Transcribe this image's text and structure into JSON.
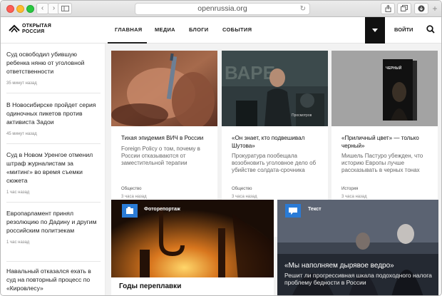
{
  "browser": {
    "url": "openrussia.org"
  },
  "site": {
    "logo_line1": "ОТКРЫТАЯ",
    "logo_line2": "РОССИЯ",
    "nav": [
      "ГЛАВНАЯ",
      "МЕДИА",
      "БЛОГИ",
      "СОБЫТИЯ"
    ],
    "login": "ВОЙТИ"
  },
  "sidebar": {
    "items": [
      {
        "title": "Суд освободил убившую ребенка няню от уголовной ответственности",
        "time": "35 минут назад"
      },
      {
        "title": "В Новосибирске пройдет серия одиночных пикетов против активиста Задои",
        "time": "45 минут назад"
      },
      {
        "title": "Суд в Новом Уренгое отменил штраф журналистам за «митинг» во время съемки сюжета",
        "time": "1 час назад"
      },
      {
        "title": "Европарламент принял резолюцию по Дадину и другим российским политзекам",
        "time": "1 час назад"
      },
      {
        "title": "Навальный отказался ехать в суд на повторный процесс по «Кировлесу»",
        "time": ""
      }
    ]
  },
  "cards": [
    {
      "title": "Тихая эпидемия ВИЧ в России",
      "lead": "Foreign Policy о том, почему в России отказываются от заместительной терапии",
      "category": "Общество",
      "time": "3 часа назад"
    },
    {
      "title": "«Он знает, кто подвешивал Шутова»",
      "lead": "Прокуратура пообещала возобновить уголовное дело об убийстве солдата-срочника",
      "category": "Общество",
      "time": "3 часа назад",
      "image_overlay": "Просмотров"
    },
    {
      "title": "«Приличный цвет» — только черный»",
      "lead": "Мишель Пастуро убежден, что историю Европы лучше рассказывать в черных тонах",
      "category": "История",
      "time": "3 часа назад",
      "book_title": "ЧЕРНЫЙ"
    }
  ],
  "features": [
    {
      "label": "Фоторепортаж",
      "title": "Годы переплавки",
      "label_color": "#2a7bd6"
    },
    {
      "label": "Текст",
      "title": "«Мы наполняем дырявое ведро»",
      "lead": "Решит ли прогрессивная шкала подоходного налога проблему бедности в России",
      "label_color": "#2a7bd6"
    }
  ]
}
